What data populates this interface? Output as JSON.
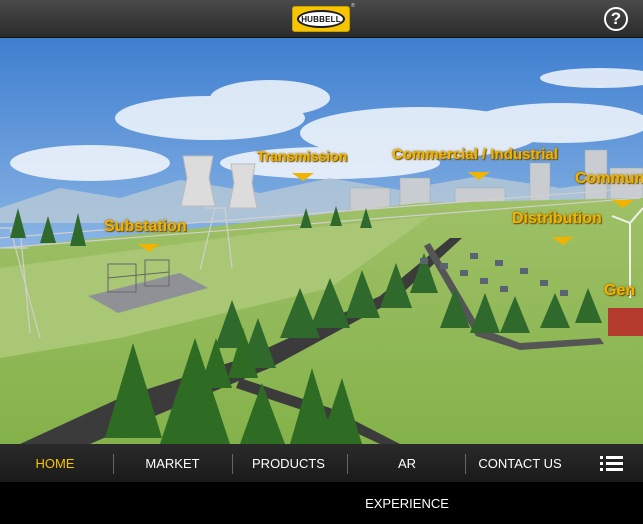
{
  "header": {
    "logo_text": "HUBBELL",
    "help_glyph": "?",
    "help_icon": "question-circle-icon"
  },
  "scene": {
    "labels": {
      "transmission": "Transmission",
      "commercial_industrial": "Commercial / Industrial",
      "community": "Communi",
      "substation": "Substation",
      "distribution": "Distribution",
      "generation": "Gen"
    }
  },
  "nav": {
    "items": [
      {
        "label": "HOME",
        "active": true
      },
      {
        "label": "MARKET",
        "active": false
      },
      {
        "label": "PRODUCTS",
        "active": false
      },
      {
        "label": "AR EXPERIENCE",
        "active": false
      },
      {
        "label": "CONTACT US",
        "active": false
      }
    ],
    "menu_icon": "hamburger-list-icon"
  },
  "colors": {
    "accent": "#f6c400",
    "label": "#f0b400",
    "bar": "#2b2b2b"
  }
}
